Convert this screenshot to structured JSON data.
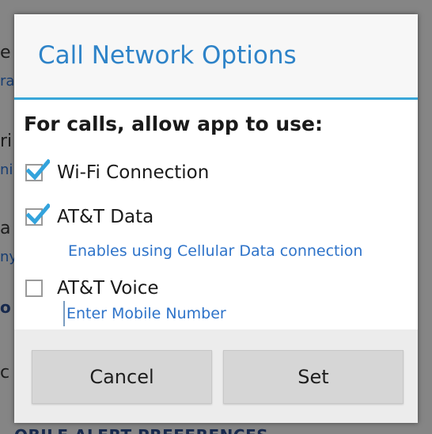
{
  "background": {
    "fragments": [
      "e",
      "ra",
      "ri",
      "ni",
      "a",
      "ny",
      "o",
      "c"
    ],
    "bottom_text": "OBILE ALERT PREFERENCES"
  },
  "dialog": {
    "title": "Call Network Options",
    "heading": "For calls, allow app to use:",
    "options": [
      {
        "label": "Wi-Fi Connection",
        "checked": true
      },
      {
        "label": "AT&T Data",
        "checked": true,
        "hint": "Enables using Cellular Data connection"
      },
      {
        "label": "AT&T Voice",
        "checked": false
      }
    ],
    "mobile_number": {
      "placeholder": "Enter Mobile Number",
      "value": ""
    },
    "buttons": {
      "cancel": "Cancel",
      "set": "Set"
    }
  },
  "colors": {
    "accent": "#3aa7d9",
    "title": "#2e83c8",
    "check": "#33a3dc",
    "hint": "#2e73c9"
  }
}
